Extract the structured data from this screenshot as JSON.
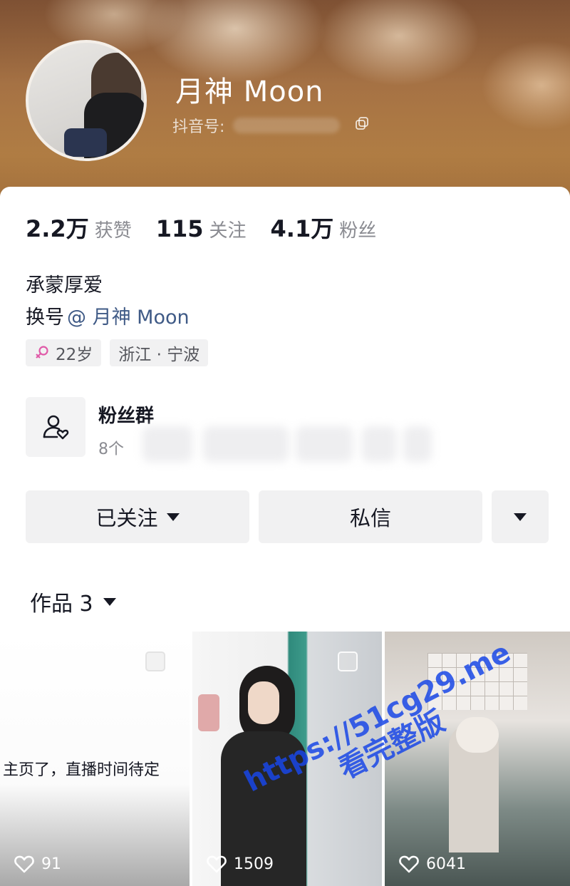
{
  "profile": {
    "nickname": "月神 Moon",
    "douyin_id_label": "抖音号:"
  },
  "stats": [
    {
      "value": "2.2万",
      "label": "获赞"
    },
    {
      "value": "115",
      "label": "关注"
    },
    {
      "value": "4.1万",
      "label": "粉丝"
    }
  ],
  "bio": {
    "line1": "承蒙厚爱",
    "line2_prefix": "换号",
    "line2_mention": "@ 月神 Moon"
  },
  "tags": {
    "age": "22岁",
    "location": "浙江 · 宁波"
  },
  "fan_group": {
    "title": "粉丝群",
    "count": "8个"
  },
  "actions": {
    "follow_label": "已关注",
    "message_label": "私信"
  },
  "works_tab": {
    "label": "作品 3"
  },
  "videos": [
    {
      "caption": "主页了，直播时间待定",
      "likes": "91"
    },
    {
      "caption": "",
      "likes": "1509"
    },
    {
      "caption": "",
      "likes": "6041"
    }
  ],
  "watermark": {
    "line1": "https://51cg29.me",
    "line2": "看完整版"
  },
  "colors": {
    "mention": "#3f5a86",
    "watermark": "#1946e6",
    "female_symbol": "#e05aa8"
  }
}
